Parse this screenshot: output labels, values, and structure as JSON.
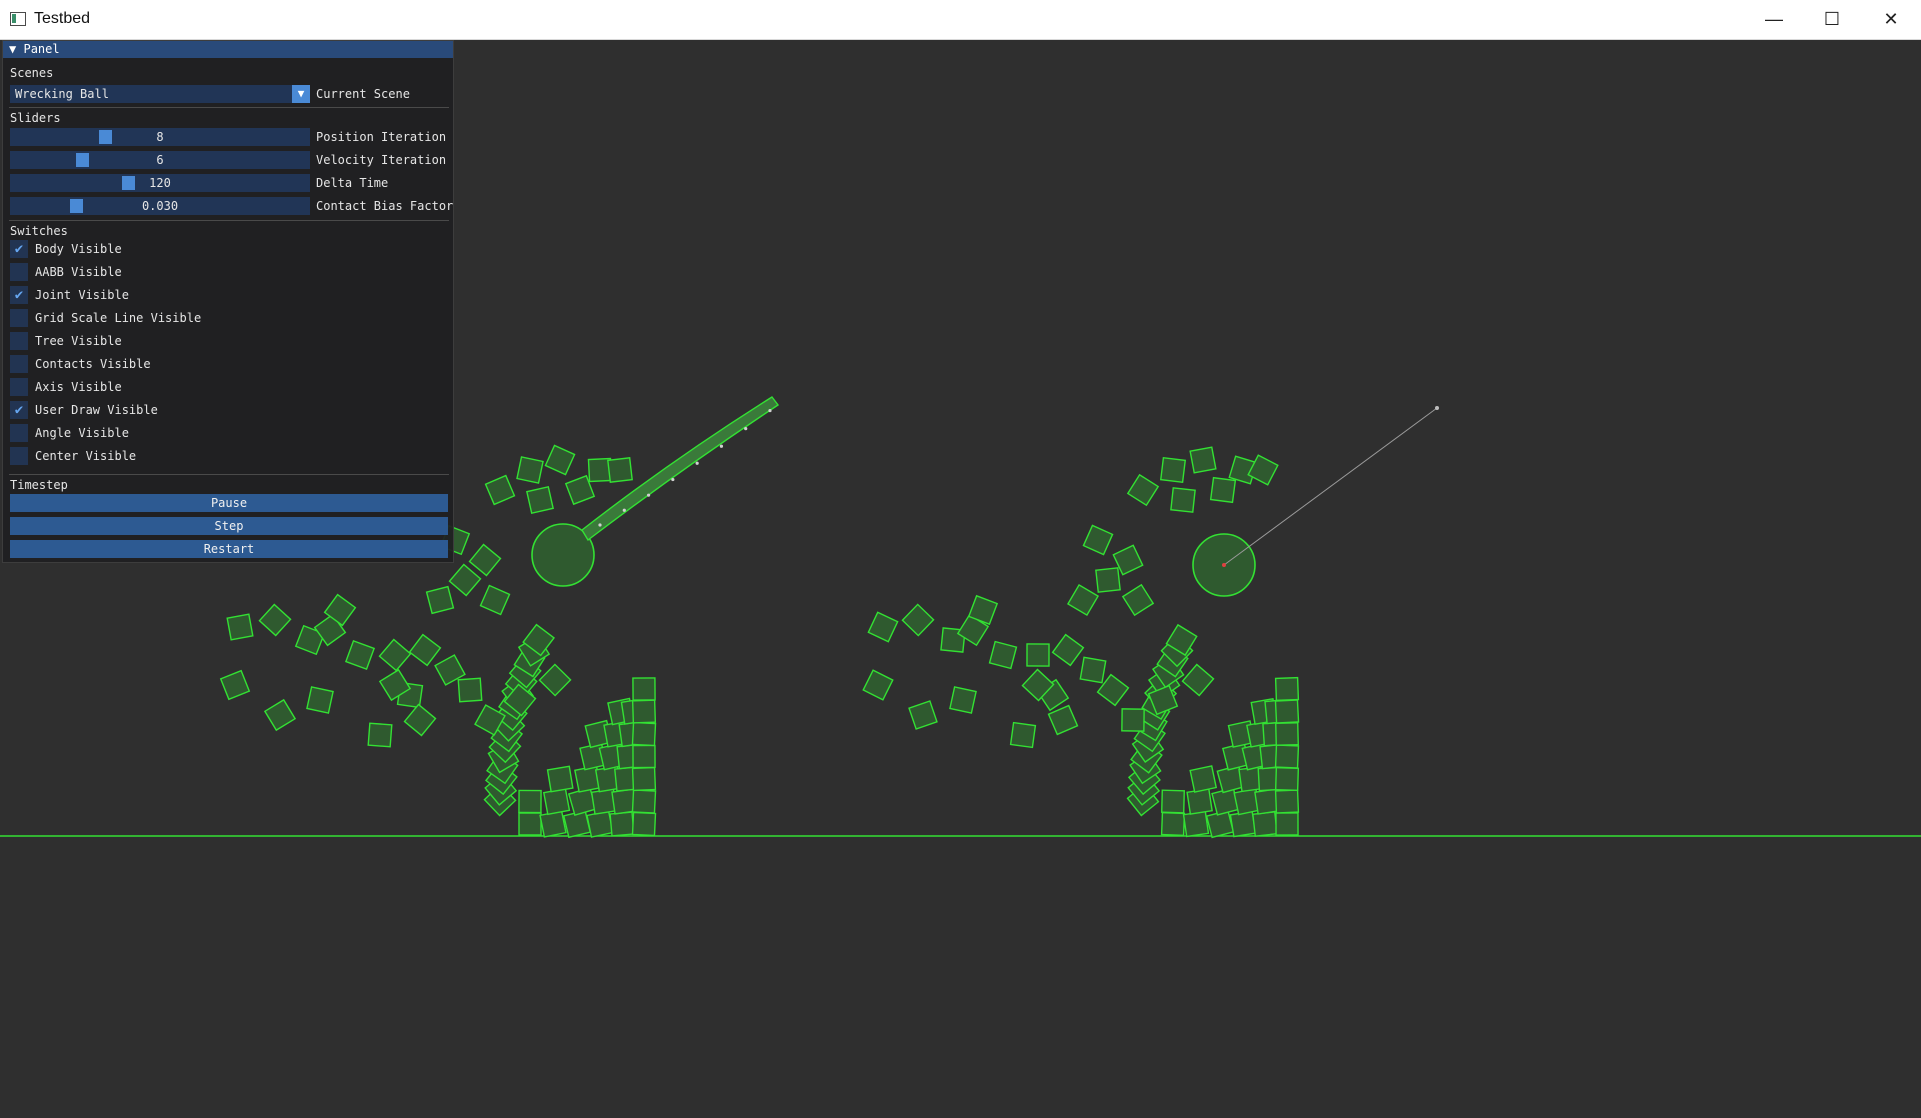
{
  "window": {
    "title": "Testbed",
    "icon": "app-window-icon",
    "controls": [
      "minimize-icon",
      "maximize-icon",
      "close-icon"
    ]
  },
  "panel": {
    "header": "Panel",
    "scenes": {
      "section_label": "Scenes",
      "selected": "Wrecking Ball",
      "combo_label": "Current Scene"
    },
    "sliders": {
      "section_label": "Sliders",
      "items": [
        {
          "label": "Position Iteration",
          "value": "8",
          "fraction": 0.31
        },
        {
          "label": "Velocity Iteration",
          "value": "6",
          "fraction": 0.23
        },
        {
          "label": "Delta Time",
          "value": "120",
          "fraction": 0.39
        },
        {
          "label": "Contact Bias Factor",
          "value": "0.030",
          "fraction": 0.21
        }
      ]
    },
    "switches": {
      "section_label": "Switches",
      "items": [
        {
          "label": "Body Visible",
          "checked": true
        },
        {
          "label": "AABB Visible",
          "checked": false
        },
        {
          "label": "Joint Visible",
          "checked": true
        },
        {
          "label": "Grid Scale Line Visible",
          "checked": false
        },
        {
          "label": "Tree Visible",
          "checked": false
        },
        {
          "label": "Contacts Visible",
          "checked": false
        },
        {
          "label": "Axis Visible",
          "checked": false
        },
        {
          "label": "User Draw Visible",
          "checked": true
        },
        {
          "label": "Angle Visible",
          "checked": false
        },
        {
          "label": "Center Visible",
          "checked": false
        }
      ]
    },
    "timestep": {
      "section_label": "Timestep",
      "buttons": [
        "Pause",
        "Step",
        "Restart"
      ]
    }
  },
  "colors": {
    "background": "#2f2f2f",
    "body_stroke": "#33e133",
    "body_fill": "#2f5a2f",
    "panel_header": "#294a7a",
    "accent": "#4a8ad6"
  }
}
